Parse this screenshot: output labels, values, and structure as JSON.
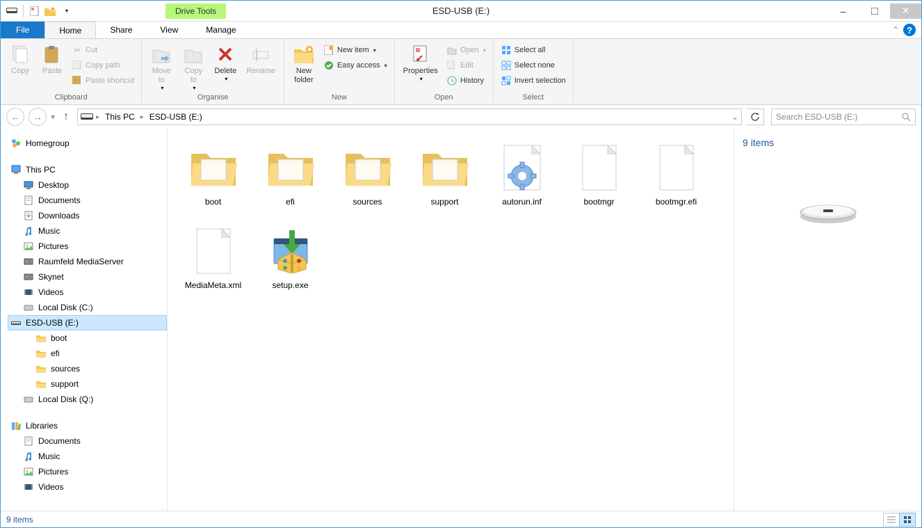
{
  "title": "ESD-USB (E:)",
  "drive_tools_label": "Drive Tools",
  "tabs": {
    "file": "File",
    "home": "Home",
    "share": "Share",
    "view": "View",
    "manage": "Manage"
  },
  "ribbon": {
    "clipboard": {
      "label": "Clipboard",
      "copy": "Copy",
      "paste": "Paste",
      "cut": "Cut",
      "copy_path": "Copy path",
      "paste_shortcut": "Paste shortcut"
    },
    "organise": {
      "label": "Organise",
      "move_to": "Move\nto",
      "copy_to": "Copy\nto",
      "delete": "Delete",
      "rename": "Rename"
    },
    "new": {
      "label": "New",
      "new_folder": "New\nfolder",
      "new_item": "New item",
      "easy_access": "Easy access"
    },
    "open": {
      "label": "Open",
      "properties": "Properties",
      "open": "Open",
      "edit": "Edit",
      "history": "History"
    },
    "select": {
      "label": "Select",
      "select_all": "Select all",
      "select_none": "Select none",
      "invert": "Invert selection"
    }
  },
  "breadcrumb": {
    "root": "This PC",
    "current": "ESD-USB (E:)"
  },
  "search_placeholder": "Search ESD-USB (E:)",
  "nav": {
    "homegroup": "Homegroup",
    "this_pc": "This PC",
    "this_pc_items": [
      "Desktop",
      "Documents",
      "Downloads",
      "Music",
      "Pictures",
      "Raumfeld MediaServer",
      "Skynet",
      "Videos",
      "Local Disk (C:)",
      "ESD-USB (E:)"
    ],
    "esd_children": [
      "boot",
      "efi",
      "sources",
      "support"
    ],
    "local_disk_q": "Local Disk (Q:)",
    "libraries": "Libraries",
    "library_items": [
      "Documents",
      "Music",
      "Pictures",
      "Videos"
    ]
  },
  "files": [
    {
      "name": "boot",
      "type": "folder"
    },
    {
      "name": "efi",
      "type": "folder"
    },
    {
      "name": "sources",
      "type": "folder"
    },
    {
      "name": "support",
      "type": "folder"
    },
    {
      "name": "autorun.inf",
      "type": "inf"
    },
    {
      "name": "bootmgr",
      "type": "file"
    },
    {
      "name": "bootmgr.efi",
      "type": "file"
    },
    {
      "name": "MediaMeta.xml",
      "type": "file"
    },
    {
      "name": "setup.exe",
      "type": "exe"
    }
  ],
  "details": {
    "count_label": "9 items"
  },
  "status": {
    "count": "9 items"
  }
}
